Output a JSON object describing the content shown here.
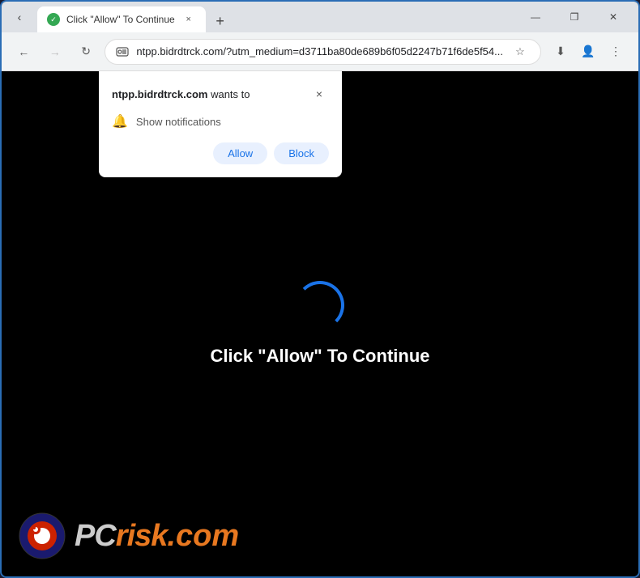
{
  "browser": {
    "tab": {
      "favicon": "✓",
      "title": "Click \"Allow\" To Continue",
      "close_label": "×"
    },
    "new_tab_label": "+",
    "window_controls": {
      "minimize": "—",
      "maximize": "❐",
      "close": "✕"
    },
    "address_bar": {
      "back_label": "←",
      "forward_label": "→",
      "refresh_label": "↻",
      "url": "ntpp.bidrdtrck.com/?utm_medium=d3711ba80de689b6f05d2247b71f6de5f54...",
      "star_label": "☆",
      "download_label": "⬇",
      "profile_label": "👤",
      "menu_label": "⋮"
    }
  },
  "permission_popup": {
    "site": "ntpp.bidrdtrck.com",
    "wants_to": "wants to",
    "close_label": "×",
    "notification_label": "Show notifications",
    "allow_label": "Allow",
    "block_label": "Block"
  },
  "page": {
    "main_text": "Click \"Allow\" To Continue"
  },
  "watermark": {
    "brand": "PCrisk",
    "brand_pc": "PC",
    "brand_risk": "risk",
    "brand_com": ".com"
  }
}
